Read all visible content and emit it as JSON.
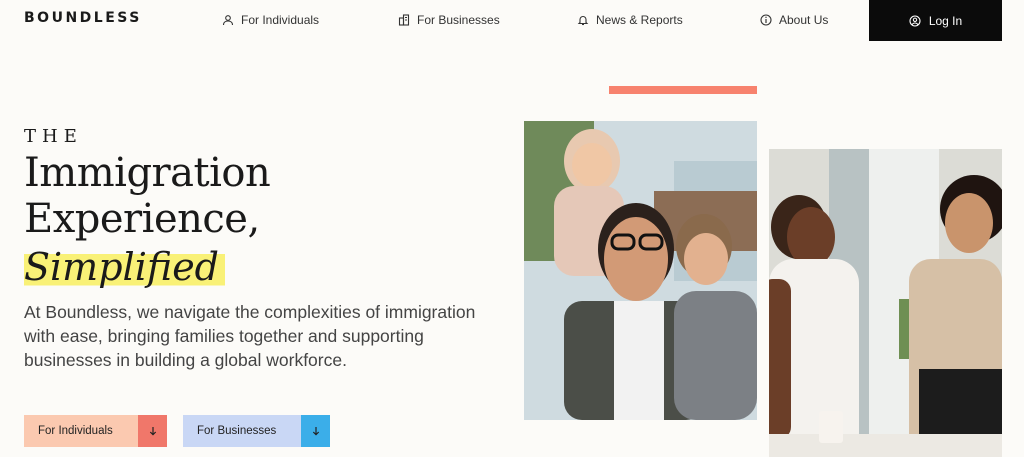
{
  "brand": {
    "logo_text": "BOUNDLESS"
  },
  "nav": {
    "items": [
      {
        "label": "For Individuals",
        "icon": "user-icon"
      },
      {
        "label": "For Businesses",
        "icon": "building-icon"
      },
      {
        "label": "News & Reports",
        "icon": "bell-icon"
      },
      {
        "label": "About Us",
        "icon": "info-icon"
      }
    ],
    "login": {
      "label": "Log In",
      "icon": "user-circle-icon"
    }
  },
  "hero": {
    "eyebrow": "THE",
    "line1": "Immigration",
    "line2": "Experience,",
    "highlight": "Simplified",
    "highlight_color": "#f9f177",
    "intro": "At Boundless, we navigate the complexities of immigration with ease, bringing families together and supporting businesses in building a global workforce."
  },
  "cta": [
    {
      "label": "For Individuals",
      "icon": "arrow-down-icon",
      "bg": "#fbc9b0",
      "accent": "#f0776a"
    },
    {
      "label": "For Businesses",
      "icon": "arrow-down-icon",
      "bg": "#c9d7f5",
      "accent": "#3baee9"
    }
  ],
  "colors": {
    "accent_bar": "#f7826e",
    "login_bg": "#0b0b0b",
    "page_bg": "#fcfbf8"
  }
}
